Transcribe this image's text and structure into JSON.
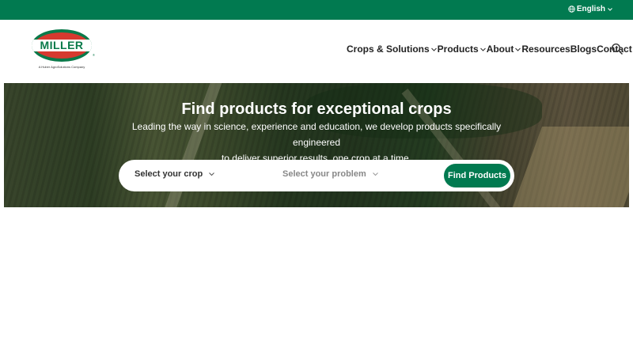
{
  "topbar": {
    "language": "English",
    "language_icon": "globe-icon",
    "bg_color": "#017a50"
  },
  "logo": {
    "text": "MILLER",
    "tagline": "A Huber AgroSolutions Company",
    "registered": "®"
  },
  "nav": {
    "items": [
      {
        "label": "Crops & Solutions",
        "has_dropdown": true
      },
      {
        "label": "Products",
        "has_dropdown": true
      },
      {
        "label": "About",
        "has_dropdown": true
      },
      {
        "label": "Resources",
        "has_dropdown": false
      },
      {
        "label": "Blogs",
        "has_dropdown": false
      },
      {
        "label": "Contact",
        "has_dropdown": true
      }
    ],
    "search_icon": "search-icon"
  },
  "hero": {
    "title": "Find products for exceptional crops",
    "subtitle_line1": "Leading the way in science, experience and education, we develop products specifically engineered",
    "subtitle_line2": "to deliver superior results, one crop at a time.",
    "crop_select": "Select your crop",
    "problem_select": "Select your problem",
    "find_button": "Find Products"
  },
  "colors": {
    "accent": "#017a50",
    "logo_red": "#d6392f",
    "logo_green": "#0a7a4a"
  }
}
